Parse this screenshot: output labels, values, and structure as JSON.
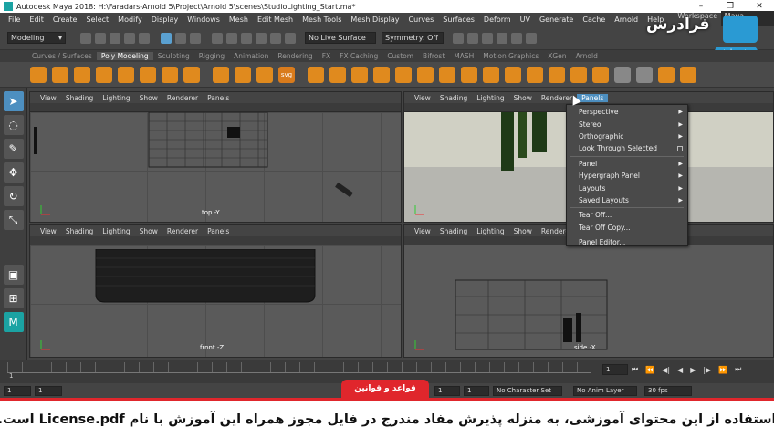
{
  "window": {
    "title": "Autodesk Maya 2018: H:\\Faradars-Arnold 5\\Project\\Arnold 5\\scenes\\StudioLighting_Start.ma*",
    "controls": [
      "–",
      "❐",
      "✕"
    ]
  },
  "menubar": {
    "items": [
      "File",
      "Edit",
      "Create",
      "Select",
      "Modify",
      "Display",
      "Windows",
      "Mesh",
      "Edit Mesh",
      "Mesh Tools",
      "Mesh Display",
      "Curves",
      "Surfaces",
      "Deform",
      "UV",
      "Generate",
      "Cache",
      "Arnold",
      "Help"
    ],
    "workspace_label": "Workspace :",
    "workspace_value": "Maya Classic*"
  },
  "statusline": {
    "mode": "Modeling",
    "live_surface": "No Live Surface",
    "symmetry": "Symmetry: Off"
  },
  "shelf": {
    "tabs": [
      "Curves / Surfaces",
      "Poly Modeling",
      "Sculpting",
      "Rigging",
      "Animation",
      "Rendering",
      "FX",
      "FX Caching",
      "Custom",
      "Bifrost",
      "MASH",
      "Motion Graphics",
      "XGen",
      "Arnold"
    ],
    "active_tab": "Poly Modeling",
    "svg_label": "svg"
  },
  "viewports": {
    "menu": [
      "View",
      "Shading",
      "Lighting",
      "Show",
      "Renderer",
      "Panels"
    ],
    "top": {
      "label": "top -Y"
    },
    "front": {
      "label": "front -Z"
    },
    "side": {
      "label": "side -X"
    }
  },
  "panels_menu": {
    "items": [
      {
        "label": "Perspective",
        "arrow": "▶"
      },
      {
        "label": "Stereo",
        "arrow": "▶"
      },
      {
        "label": "Orthographic",
        "arrow": "▶"
      },
      {
        "label": "Look Through Selected",
        "checkbox": true
      },
      {
        "sep": true
      },
      {
        "label": "Panel",
        "arrow": "▶"
      },
      {
        "label": "Hypergraph Panel",
        "arrow": "▶"
      },
      {
        "label": "Layouts",
        "arrow": "▶"
      },
      {
        "label": "Saved Layouts",
        "arrow": "▶"
      },
      {
        "sep": true
      },
      {
        "label": "Tear Off..."
      },
      {
        "label": "Tear Off Copy..."
      },
      {
        "sep": true
      },
      {
        "label": "Panel Editor..."
      }
    ]
  },
  "timeslider": {
    "current_frame": "1",
    "tick_1": "1",
    "start_field": "1",
    "range_start": "1",
    "range_end_1": "1",
    "range_end_2": "1",
    "no_character_set": "No Character Set",
    "no_anim_layer": "No Anim Layer",
    "fps": "30 fps"
  },
  "watermark": {
    "brand": "فرادرس",
    "preview": "پیش نمایش"
  },
  "notice": {
    "tab": "قواعد و قوانین",
    "text": "استفاده از این محتوای آموزشی، به منزله پذیرش مفاد مندرج در فایل مجوز همراه این آموزش با نام License.pdf است."
  },
  "colors": {
    "accent": "#4d8fc0",
    "shelf_orange": "#e08a1e",
    "notice_red": "#e0262c",
    "watermark_blue": "#2a9ad3"
  }
}
